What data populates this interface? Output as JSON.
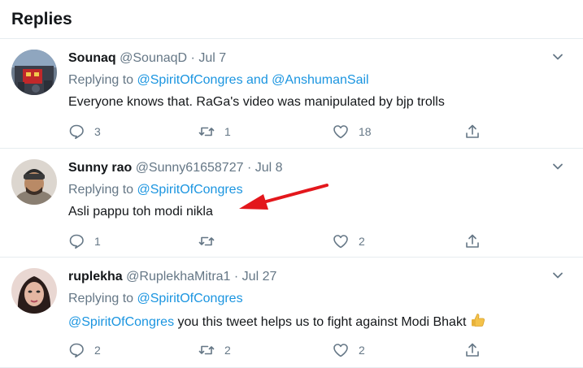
{
  "header": {
    "title": "Replies"
  },
  "colors": {
    "link": "#1b95e0",
    "muted": "#657786",
    "arrow": "#e3171c"
  },
  "replies": [
    {
      "name": "Sounaq",
      "handle": "@SounaqD",
      "date": "Jul 7",
      "replying_prefix": "Replying to",
      "replying_to_1": "@SpiritOfCongres",
      "replying_and": "and",
      "replying_to_2": "@AnshumanSail",
      "text": "Everyone knows that. RaGa's video was manipulated by bjp trolls",
      "reply_count": "3",
      "retweet_count": "1",
      "like_count": "18"
    },
    {
      "name": "Sunny rao",
      "handle": "@Sunny61658727",
      "date": "Jul 8",
      "replying_prefix": "Replying to",
      "replying_to_1": "@SpiritOfCongres",
      "text": "Asli pappu toh modi nikla",
      "reply_count": "1",
      "retweet_count": "",
      "like_count": "2"
    },
    {
      "name": "ruplekha",
      "handle": "@RuplekhaMitra1",
      "date": "Jul 27",
      "replying_prefix": "Replying to",
      "replying_to_1": "@SpiritOfCongres",
      "text_mention": "@SpiritOfCongres",
      "text": "you this tweet helps us to fight against Modi Bhakt",
      "emoji": "thumbs-up",
      "reply_count": "2",
      "retweet_count": "2",
      "like_count": "2"
    }
  ],
  "icons": {
    "reply": "reply-icon",
    "retweet": "retweet-icon",
    "like": "like-icon",
    "share": "share-icon",
    "more": "chevron-down-icon",
    "annotation": "red-arrow"
  }
}
